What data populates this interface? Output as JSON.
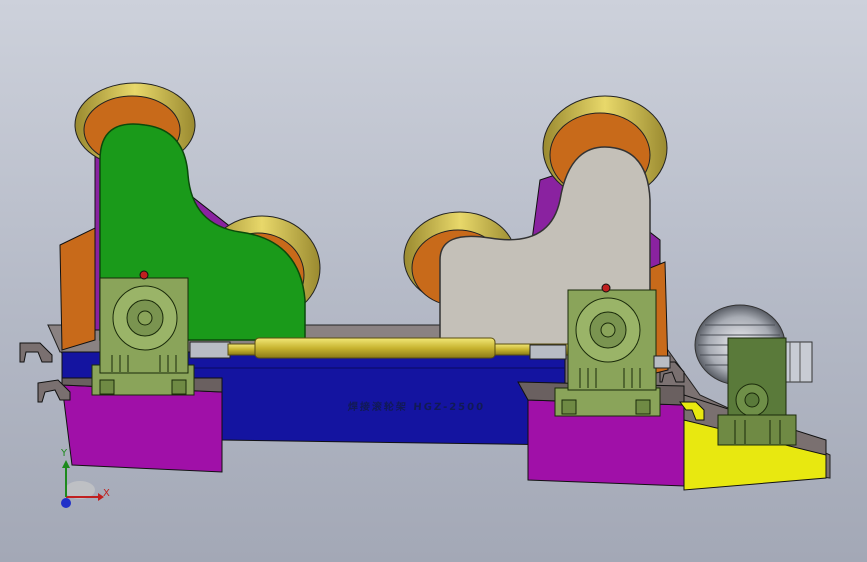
{
  "model": {
    "engraving_text": "焊接滚轮架 HGZ-2500",
    "colors": {
      "background_top": "#cdd1db",
      "background_bottom": "#a3a8b6",
      "frame_blue": "#1414a0",
      "base_plate": "#7a7070",
      "foot_magenta": "#a010a8",
      "motor_base_yellow": "#e8e810",
      "left_bracket_green": "#1a9a1a",
      "right_bracket_grey": "#c4c0b8",
      "bracket_purple": "#8a22a0",
      "roller_orange": "#c86a1a",
      "roller_tire_yellow": "#d8c848",
      "gearbox_green": "#8aa45a",
      "shaft_gold": "#d0c040"
    },
    "parts": [
      "left-roller-bracket",
      "right-roller-bracket",
      "left-worm-gearbox",
      "right-worm-gearbox",
      "drive-shaft",
      "drive-motor",
      "motor-gearbox",
      "base-frame"
    ]
  },
  "triad": {
    "x_label": "X",
    "y_label": "Y"
  }
}
